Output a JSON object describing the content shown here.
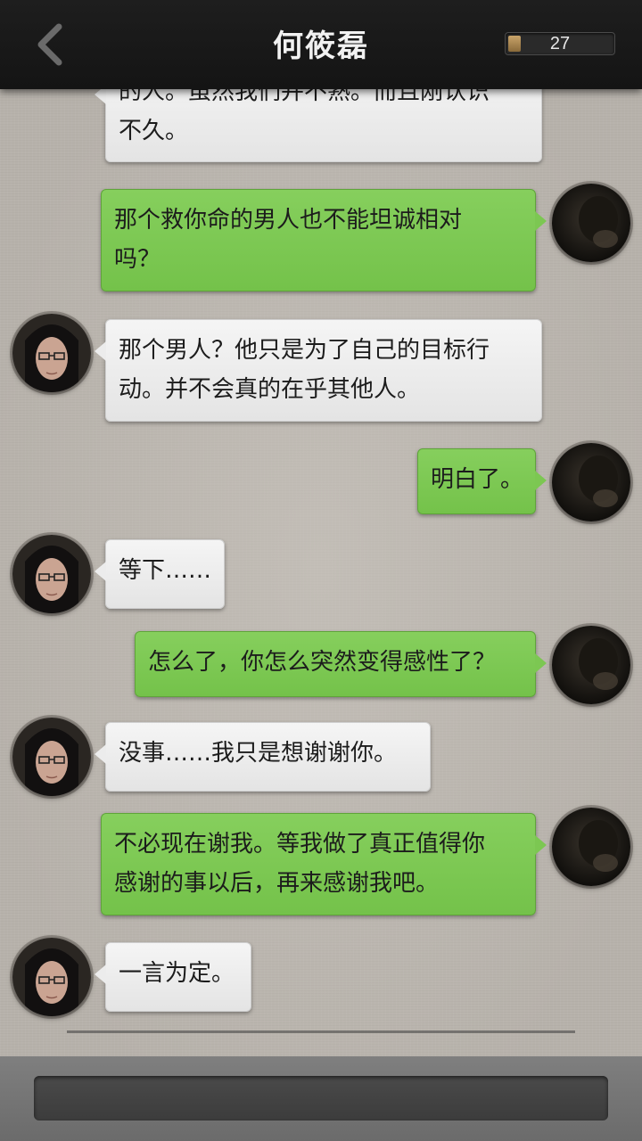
{
  "header": {
    "title": "何筱磊",
    "counter": "27",
    "back_icon": "chevron-left-icon"
  },
  "colors": {
    "header_bg": "#1a1a1a",
    "sent_bubble": "#7cc752",
    "received_bubble": "#ececec",
    "input_bg": "#444444"
  },
  "messages": [
    {
      "side": "left",
      "text": "的人。虽然我们并不熟。而且刚认识不久。",
      "line1": "的人。虽然我们并不熟。而且刚认识",
      "line2": "不久。"
    },
    {
      "side": "right",
      "line1": "那个救你命的男人也不能坦诚相对",
      "line2": "吗？"
    },
    {
      "side": "left",
      "line1": "那个男人？他只是为了自己的目标行",
      "line2": "动。并不会真的在乎其他人。"
    },
    {
      "side": "right",
      "line1": "明白了。"
    },
    {
      "side": "left",
      "line1": "等下……"
    },
    {
      "side": "right",
      "line1": "怎么了，你怎么突然变得感性了？"
    },
    {
      "side": "left",
      "line1": "没事……我只是想谢谢你。"
    },
    {
      "side": "right",
      "line1": "不必现在谢我。等我做了真正值得你",
      "line2": "感谢的事以后，再来感谢我吧。"
    },
    {
      "side": "left",
      "line1": "一言为定。"
    }
  ],
  "input": {
    "placeholder": ""
  }
}
